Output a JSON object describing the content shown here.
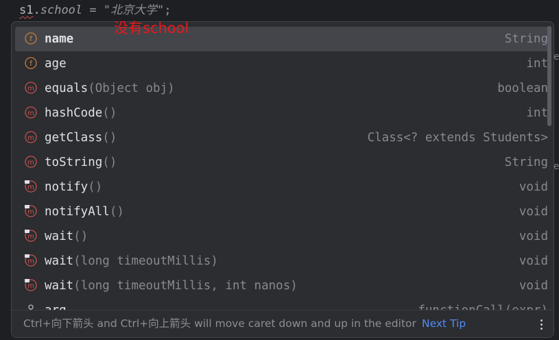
{
  "editor": {
    "code": {
      "var": "s1",
      "dot": ".",
      "field": "school",
      "op": " = ",
      "string": "\"北京大学\"",
      "semi": ";"
    }
  },
  "annotation": "没有school",
  "completion": {
    "items": [
      {
        "kind": "field",
        "name": "name",
        "params": "",
        "type": "String",
        "selected": true
      },
      {
        "kind": "field",
        "name": "age",
        "params": "",
        "type": "int",
        "selected": false
      },
      {
        "kind": "method",
        "name": "equals",
        "params": "(Object obj)",
        "type": "boolean",
        "selected": false
      },
      {
        "kind": "method",
        "name": "hashCode",
        "params": "()",
        "type": "int",
        "selected": false
      },
      {
        "kind": "method",
        "name": "getClass",
        "params": "()",
        "type": "Class<? extends Students>",
        "selected": false
      },
      {
        "kind": "method",
        "name": "toString",
        "params": "()",
        "type": "String",
        "selected": false
      },
      {
        "kind": "method-locked",
        "name": "notify",
        "params": "()",
        "type": "void",
        "selected": false
      },
      {
        "kind": "method-locked",
        "name": "notifyAll",
        "params": "()",
        "type": "void",
        "selected": false
      },
      {
        "kind": "method-locked",
        "name": "wait",
        "params": "()",
        "type": "void",
        "selected": false
      },
      {
        "kind": "method-locked",
        "name": "wait",
        "params": "(long timeoutMillis)",
        "type": "void",
        "selected": false
      },
      {
        "kind": "method-locked",
        "name": "wait",
        "params": "(long timeoutMillis, int nanos)",
        "type": "void",
        "selected": false
      },
      {
        "kind": "template",
        "name": "arg",
        "params": "",
        "type": "functionCall(expr)",
        "selected": false
      }
    ],
    "footer": {
      "tip": "Ctrl+向下箭头 and Ctrl+向上箭头 will move caret down and up in the editor",
      "next_tip": "Next Tip",
      "more_icon": "more-vertical-icon"
    }
  },
  "colors": {
    "field_icon": "#c77f3b",
    "method_icon": "#c94f4f",
    "link": "#548af7",
    "annotation": "#e8191c"
  }
}
